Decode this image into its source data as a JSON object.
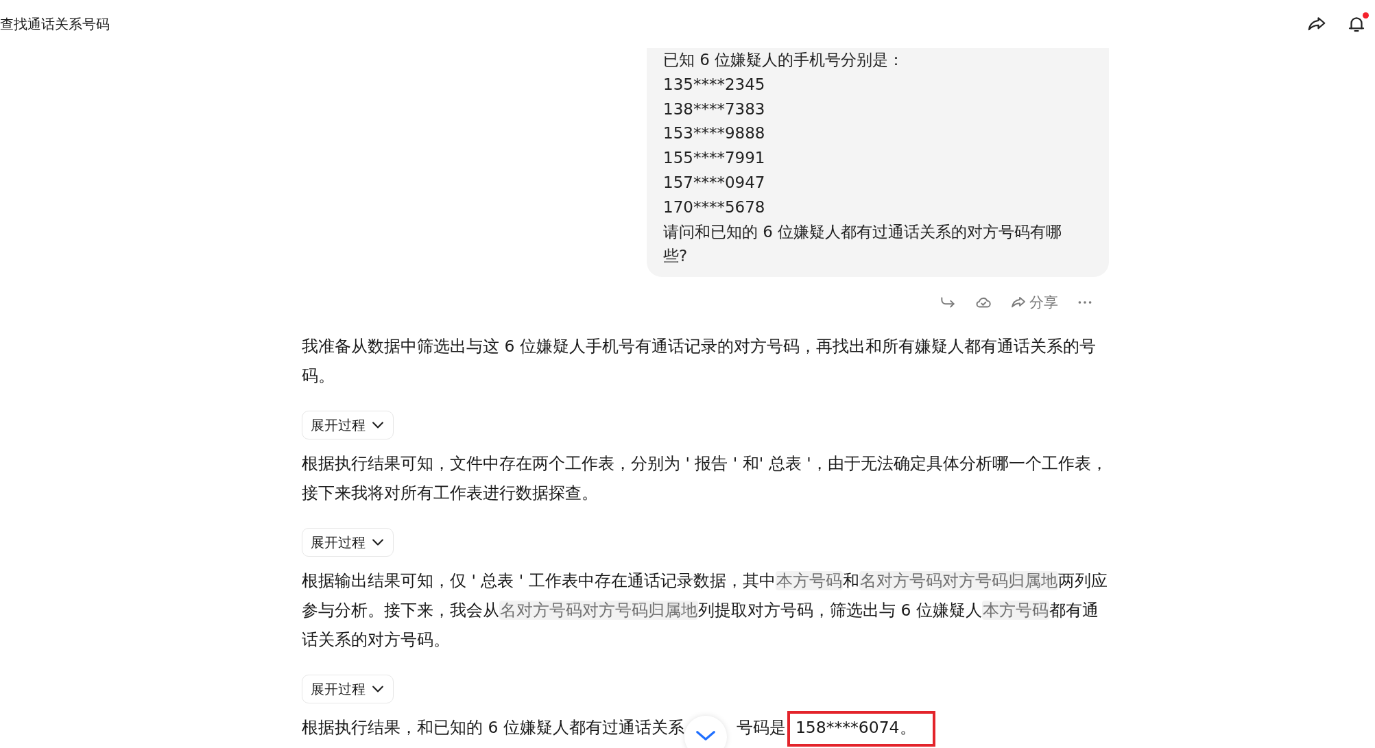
{
  "header": {
    "title": "查找通话关系号码",
    "notification": {
      "unread": true
    }
  },
  "user_message": {
    "lines": [
      "已知 6 位嫌疑人的手机号分别是：",
      "135****2345",
      "138****7383",
      "153****9888",
      "155****7991",
      "157****0947",
      "170****5678",
      "请问和已知的 6 位嫌疑人都有过通话关系的对方号码有哪些?"
    ]
  },
  "message_actions": [
    {
      "kind": "reply"
    },
    {
      "kind": "cloud"
    },
    {
      "kind": "share",
      "label": "分享"
    },
    {
      "kind": "more"
    }
  ],
  "response": [
    {
      "kind": "paragraph",
      "segments": [
        {
          "kind": "plain",
          "text": "我准备从数据中筛选出与这 6 位嫌疑人手机号有通话记录的对方号码，再找出和所有嫌疑人都有通话关系的号码。"
        }
      ]
    },
    {
      "kind": "expand",
      "label": "展开过程"
    },
    {
      "kind": "paragraph",
      "segments": [
        {
          "kind": "plain",
          "text": "根据执行结果可知，文件中存在两个工作表，分别为 ' 报告 ' 和' 总表 '，由于无法确定具体分析哪一个工作表，接下来我将对所有工作表进行数据探查。"
        }
      ]
    },
    {
      "kind": "expand",
      "label": "展开过程"
    },
    {
      "kind": "paragraph",
      "segments": [
        {
          "kind": "plain",
          "text": "根据输出结果可知，仅 ' 总表 ' 工作表中存在通话记录数据，其中"
        },
        {
          "kind": "code",
          "text": "本方号码"
        },
        {
          "kind": "plain",
          "text": "和"
        },
        {
          "kind": "code",
          "text": "名对方号码对方号码归属地"
        },
        {
          "kind": "plain",
          "text": "两列应参与分析。接下来，我会从"
        },
        {
          "kind": "code",
          "text": "名对方号码对方号码归属地"
        },
        {
          "kind": "plain",
          "text": "列提取对方号码，筛选出与 6 位嫌疑人"
        },
        {
          "kind": "code",
          "text": "本方号码"
        },
        {
          "kind": "plain",
          "text": "都有通话关系的对方号码。"
        }
      ]
    },
    {
      "kind": "expand",
      "label": "展开过程"
    },
    {
      "kind": "paragraph",
      "segments": [
        {
          "kind": "plain",
          "text": "根据执行结果，和已知的 6 位嫌疑人都有过通话关系"
        },
        {
          "kind": "tail",
          "text": "号码是"
        },
        {
          "kind": "highlight",
          "text": "158****6074。"
        }
      ]
    }
  ],
  "scroll_button": {
    "kind": "down"
  }
}
